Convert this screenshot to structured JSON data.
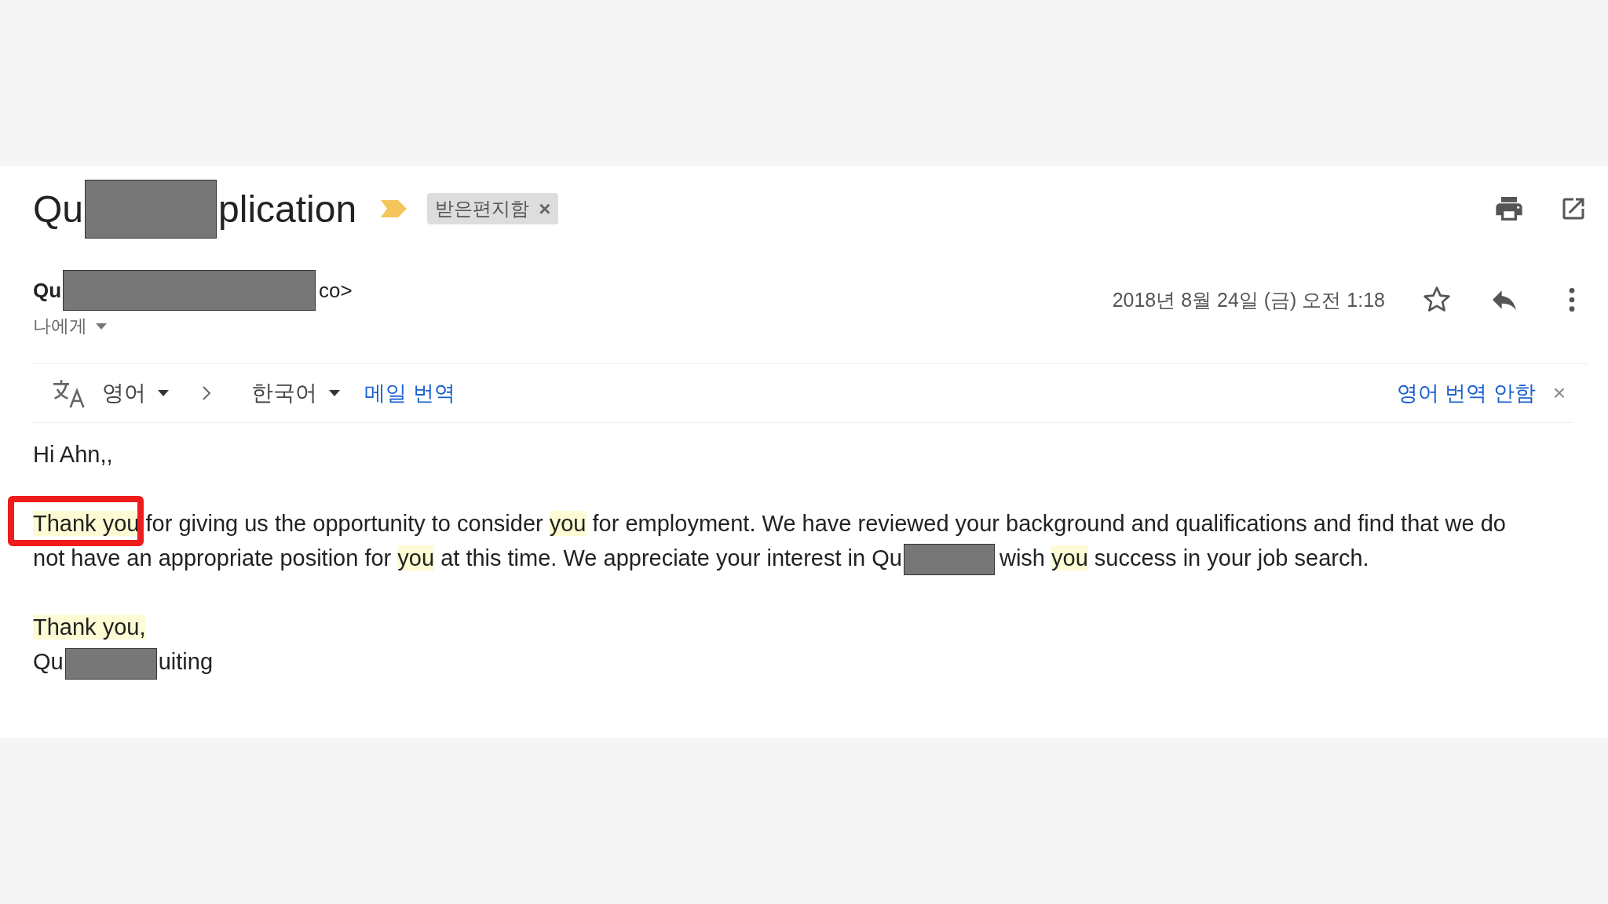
{
  "subject": {
    "segments": [
      {
        "kind": "text",
        "text": "Qu"
      },
      {
        "kind": "redacted"
      },
      {
        "kind": "text",
        "text": "plication"
      }
    ],
    "important": true,
    "label": {
      "text": "받은편지함",
      "remove": "×"
    }
  },
  "sender": {
    "segments": [
      {
        "kind": "text",
        "text": "Qu"
      },
      {
        "kind": "redacted"
      },
      {
        "kind": "text",
        "text": "co>"
      }
    ],
    "recipient": "나에게",
    "date": "2018년 8월 24일 (금) 오전 1:18",
    "starred": false
  },
  "translation": {
    "source": "영어",
    "target": "한국어",
    "action": "메일 번역",
    "turn_off": "영어 번역 안함",
    "close": "×"
  },
  "body": {
    "greeting": "Hi Ahn,,",
    "paragraph": [
      {
        "kind": "text",
        "text": "Thank you",
        "highlighted": true
      },
      {
        "kind": "text",
        "text": " for giving us the opportunity to consider ",
        "highlighted": false
      },
      {
        "kind": "text",
        "text": "you",
        "highlighted": true
      },
      {
        "kind": "text",
        "text": " for employment. We have reviewed your background and qualifications and find that we do not have an appropriate position for ",
        "highlighted": false
      },
      {
        "kind": "text",
        "text": "you",
        "highlighted": true
      },
      {
        "kind": "text",
        "text": " at this time. We appreciate your interest in Qu",
        "highlighted": false
      },
      {
        "kind": "redacted"
      },
      {
        "kind": "text",
        "text": "wish ",
        "highlighted": false
      },
      {
        "kind": "text",
        "text": "you",
        "highlighted": true
      },
      {
        "kind": "text",
        "text": " success in your job search.",
        "highlighted": false
      }
    ],
    "closing": [
      {
        "kind": "text",
        "text": "Thank you,",
        "highlighted": true
      }
    ],
    "signature": [
      {
        "kind": "text",
        "text": "Qu",
        "highlighted": false
      },
      {
        "kind": "redacted"
      },
      {
        "kind": "text",
        "text": "uiting",
        "highlighted": false
      }
    ]
  },
  "annotation": {
    "kind": "outline"
  }
}
